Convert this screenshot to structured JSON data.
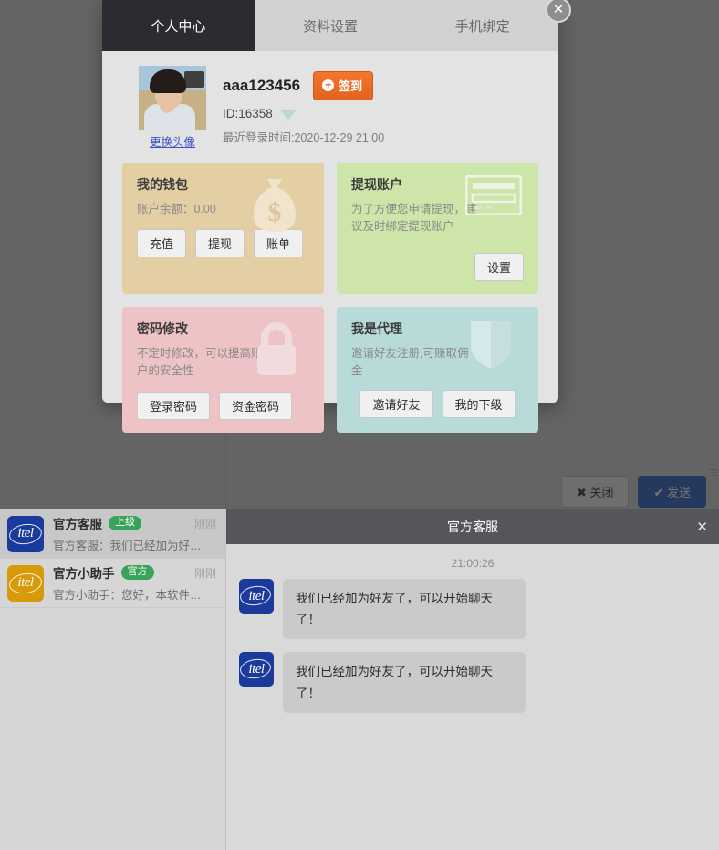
{
  "background": {
    "chat_list": [
      {
        "name": "官方客服",
        "tag": "上级",
        "tag_color": "#3aa35a",
        "time": "刚刚",
        "snippet": "官方客服：我们已经加为好友了…",
        "avatar_text": "itel",
        "avatar_color": "#1a3a9c",
        "selected": true
      },
      {
        "name": "官方小助手",
        "tag": "官方",
        "tag_color": "#3aa35a",
        "time": "刚刚",
        "snippet": "官方小助手：您好，本软件正在…",
        "avatar_text": "itel",
        "avatar_color": "#d99a09",
        "selected": false
      }
    ],
    "chat_panel": {
      "title": "官方客服",
      "close_label": "✕",
      "timestamp": "21:00:26",
      "messages": [
        {
          "avatar_text": "itel",
          "text": "我们已经加为好友了，可以开始聊天了！"
        },
        {
          "avatar_text": "itel",
          "text": "我们已经加为好友了，可以开始聊天了！"
        }
      ]
    },
    "compose": {
      "close_label": "✖ 关闭",
      "send_label": "✔ 发送"
    }
  },
  "modal": {
    "close_label": "✕",
    "tabs": [
      {
        "label": "个人中心",
        "active": true
      },
      {
        "label": "资料设置",
        "active": false
      },
      {
        "label": "手机绑定",
        "active": false
      }
    ],
    "profile": {
      "change_avatar_label": "更换头像",
      "username": "aaa123456",
      "signin_label": "签到",
      "signin_plus": "+",
      "uid": "ID:16358",
      "last_login": "最近登录时间:2020-12-29 21:00"
    },
    "cards": {
      "wallet": {
        "title": "我的钱包",
        "desc": "账户余额：0.00",
        "buttons": [
          "充值",
          "提现",
          "账单"
        ],
        "bg": "#e3cfa3"
      },
      "withdraw": {
        "title": "提现账户",
        "desc": "为了方便您申请提现，建议及时绑定提现账户",
        "buttons": [
          "设置"
        ],
        "bg": "#cee5a9"
      },
      "password": {
        "title": "密码修改",
        "desc": "不定时修改，可以提高账户的安全性",
        "buttons": [
          "登录密码",
          "资金密码"
        ],
        "bg": "#eec3c5"
      },
      "agent": {
        "title": "我是代理",
        "desc": "邀请好友注册,可赚取佣金",
        "buttons": [
          "邀请好友",
          "我的下级"
        ],
        "bg": "#b8dbd9"
      }
    }
  }
}
